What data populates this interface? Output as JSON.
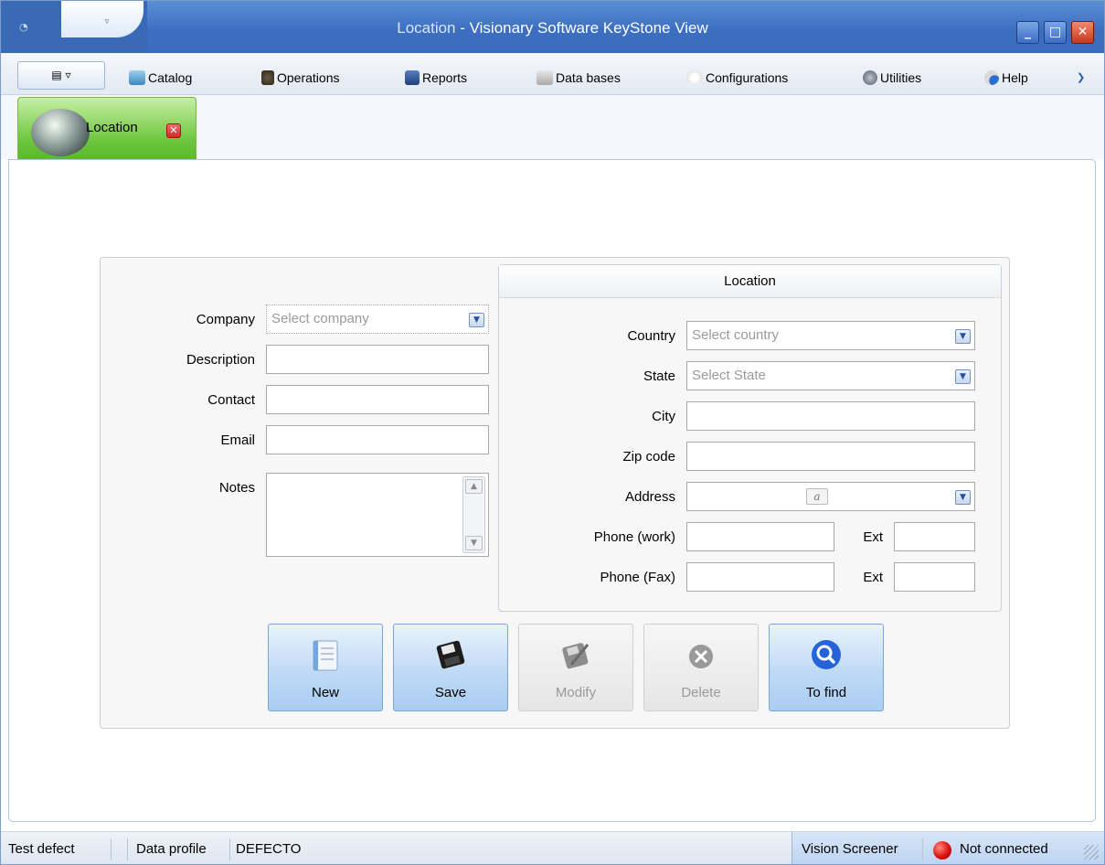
{
  "window": {
    "title_prefix": "Location",
    "title_suffix": " - Visionary Software KeyStone View"
  },
  "menu": {
    "items": [
      "Catalog",
      "Operations",
      "Reports",
      "Data bases",
      "Configurations",
      "Utilities",
      "Help"
    ]
  },
  "tab": {
    "label": "Location"
  },
  "form": {
    "company_label": "Company",
    "company_placeholder": "Select company",
    "description_label": "Description",
    "contact_label": "Contact",
    "email_label": "Email",
    "notes_label": "Notes"
  },
  "location": {
    "heading": "Location",
    "country_label": "Country",
    "country_placeholder": "Select country",
    "state_label": "State",
    "state_placeholder": "Select State",
    "city_label": "City",
    "zip_label": "Zip code",
    "address_label": "Address",
    "phone_work_label": "Phone (work)",
    "phone_fax_label": "Phone (Fax)",
    "ext_label": "Ext"
  },
  "actions": {
    "new": "New",
    "save": "Save",
    "modify": "Modify",
    "delete": "Delete",
    "find": "To find"
  },
  "status": {
    "left": "Test defect",
    "profile_label": "Data profile",
    "profile_value": "DEFECTO",
    "screener": "Vision Screener",
    "connection": "Not connected"
  },
  "colors": {
    "accent": "#3d6fc1",
    "tab_green": "#6cc53d",
    "button_blue": "#bfdaf5",
    "status_red": "#d11111"
  }
}
